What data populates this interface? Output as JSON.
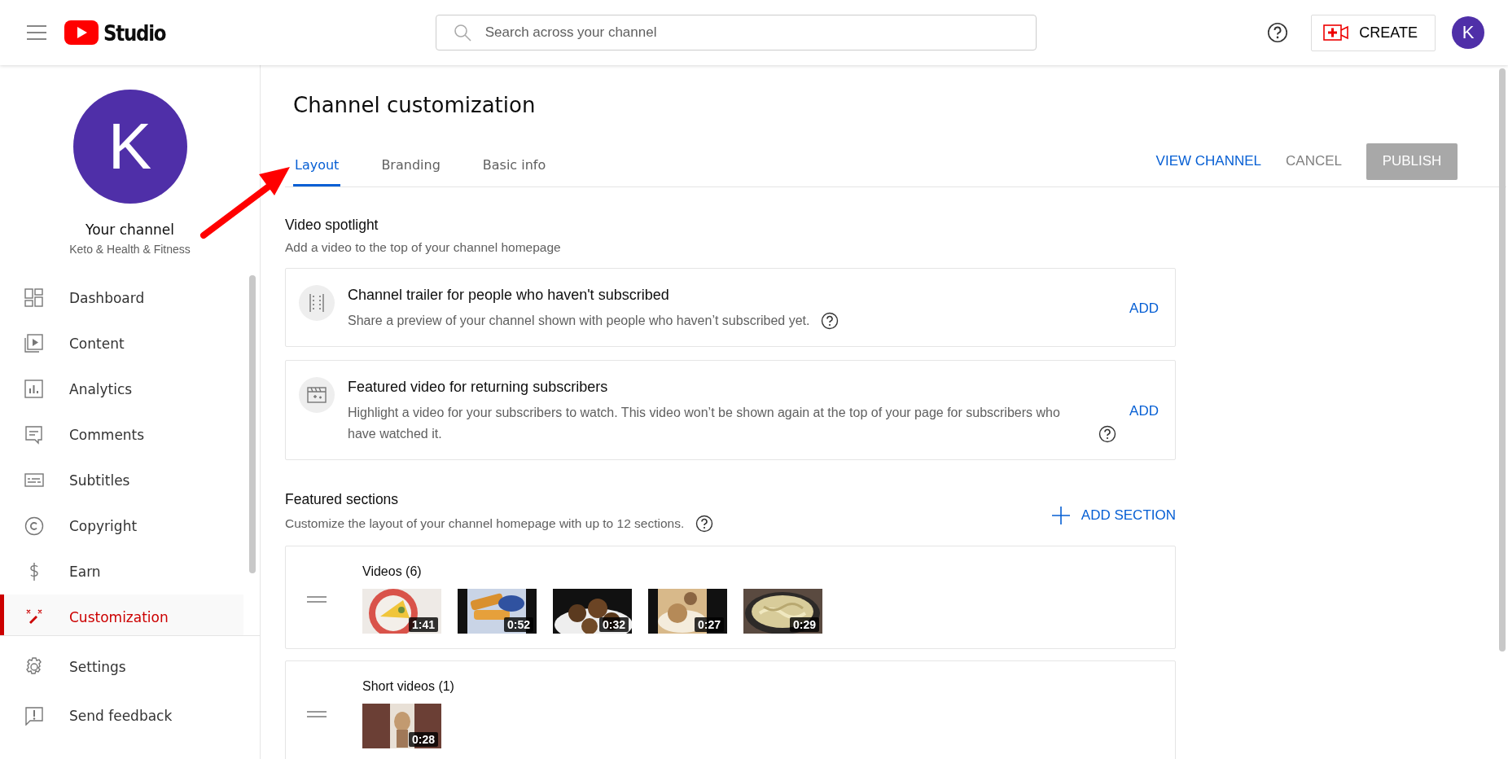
{
  "header": {
    "logo_text": "Studio",
    "search": {
      "placeholder": "Search across your channel"
    },
    "create_label": "CREATE",
    "avatar_letter": "K"
  },
  "sidebar": {
    "avatar_letter": "K",
    "channel_title": "Your channel",
    "channel_name": "Keto & Health & Fitness",
    "items": [
      {
        "label": "Dashboard",
        "kind": "dashboard",
        "selected": false
      },
      {
        "label": "Content",
        "kind": "content",
        "selected": false
      },
      {
        "label": "Analytics",
        "kind": "analytics",
        "selected": false
      },
      {
        "label": "Comments",
        "kind": "comments",
        "selected": false
      },
      {
        "label": "Subtitles",
        "kind": "subtitles",
        "selected": false
      },
      {
        "label": "Copyright",
        "kind": "copyright",
        "selected": false
      },
      {
        "label": "Earn",
        "kind": "earn",
        "selected": false
      },
      {
        "label": "Customization",
        "kind": "customization",
        "selected": true
      }
    ],
    "footer_items": [
      {
        "label": "Settings",
        "kind": "settings"
      },
      {
        "label": "Send feedback",
        "kind": "feedback"
      }
    ]
  },
  "page": {
    "title": "Channel customization",
    "tabs": [
      {
        "label": "Layout",
        "selected": true
      },
      {
        "label": "Branding",
        "selected": false
      },
      {
        "label": "Basic info",
        "selected": false
      }
    ],
    "view_channel": "VIEW CHANNEL",
    "cancel": "CANCEL",
    "publish": {
      "label": "PUBLISH",
      "disabled": true
    }
  },
  "spotlight": {
    "title": "Video spotlight",
    "description": "Add a video to the top of your channel homepage",
    "cards": [
      {
        "kind": "trailer",
        "title": "Channel trailer for people who haven't subscribed",
        "description": "Share a preview of your channel shown with people who haven’t subscribed yet.",
        "action": "ADD"
      },
      {
        "kind": "featured",
        "title": "Featured video for returning subscribers",
        "description": "Highlight a video for your subscribers to watch. This video won’t be shown again at the top of your page for subscribers who have watched it.",
        "action": "ADD"
      }
    ]
  },
  "featured": {
    "title": "Featured sections",
    "description": "Customize the layout of your channel homepage with up to 12 sections.",
    "add_label": "ADD SECTION",
    "sections": [
      {
        "title": "Videos (6)",
        "videos": [
          {
            "duration": "1:41"
          },
          {
            "duration": "0:52"
          },
          {
            "duration": "0:32"
          },
          {
            "duration": "0:27"
          },
          {
            "duration": "0:29"
          }
        ]
      },
      {
        "title": "Short videos (1)",
        "videos": [
          {
            "duration": "0:28"
          }
        ]
      }
    ]
  }
}
